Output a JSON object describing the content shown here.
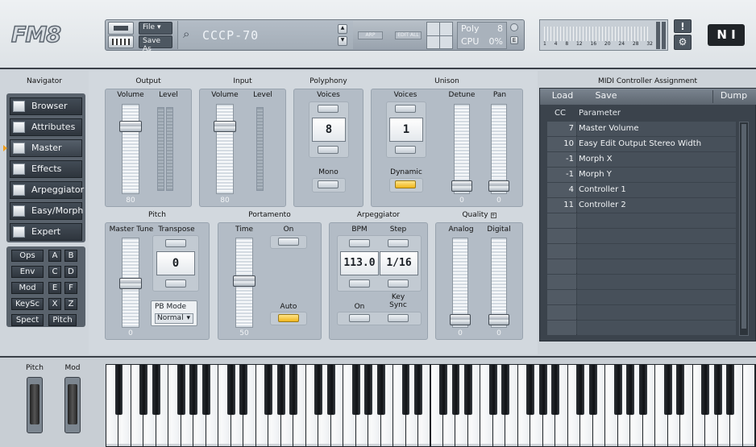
{
  "header": {
    "logo": "FM8",
    "file_label": "File",
    "saveas_label": "Save As",
    "program_name": "CCCP-70",
    "arp_label": "ARP",
    "edit_all_label": "EDIT ALL",
    "poly_label": "Poly",
    "poly_value": "8",
    "cpu_label": "CPU",
    "cpu_value": "0%",
    "spectrum_ticks": [
      "1",
      "4",
      "8",
      "12",
      "16",
      "20",
      "24",
      "28",
      "32"
    ],
    "ni_logo": "N I",
    "alert_label": "!"
  },
  "navigator": {
    "title": "Navigator",
    "items": [
      {
        "label": "Browser",
        "icon": "browser-icon"
      },
      {
        "label": "Attributes",
        "icon": "attributes-icon"
      },
      {
        "label": "Master",
        "icon": "master-gear-icon"
      },
      {
        "label": "Effects",
        "icon": "effects-icon"
      },
      {
        "label": "Arpeggiator",
        "icon": "arpeggiator-icon"
      },
      {
        "label": "Easy/Morph",
        "icon": "easy-morph-icon"
      },
      {
        "label": "Expert",
        "icon": "expert-icon"
      }
    ],
    "selected": "Master",
    "grid": [
      [
        "Ops",
        "A",
        "B"
      ],
      [
        "Env",
        "C",
        "D"
      ],
      [
        "Mod",
        "E",
        "F"
      ],
      [
        "KeySc",
        "X",
        "Z"
      ],
      [
        "Spect",
        "Pitch"
      ]
    ]
  },
  "output": {
    "title": "Output",
    "volume_label": "Volume",
    "level_label": "Level",
    "volume_value": "80"
  },
  "input": {
    "title": "Input",
    "volume_label": "Volume",
    "level_label": "Level",
    "volume_value": "80"
  },
  "polyphony": {
    "title": "Polyphony",
    "voices_label": "Voices",
    "voices_value": "8",
    "mono_label": "Mono"
  },
  "unison": {
    "title": "Unison",
    "voices_label": "Voices",
    "voices_value": "1",
    "dynamic_label": "Dynamic",
    "detune_label": "Detune",
    "pan_label": "Pan",
    "detune_value": "0",
    "pan_value": "0"
  },
  "pitch": {
    "title": "Pitch",
    "master_tune_label": "Master Tune",
    "transpose_label": "Transpose",
    "transpose_value": "0",
    "master_tune_value": "0",
    "pb_mode_label": "PB Mode",
    "pb_mode_value": "Normal"
  },
  "portamento": {
    "title": "Portamento",
    "time_label": "Time",
    "on_label": "On",
    "auto_label": "Auto",
    "time_value": "50"
  },
  "arpeggiator": {
    "title": "Arpeggiator",
    "bpm_label": "BPM",
    "step_label": "Step",
    "bpm_value": "113.0",
    "step_value": "1/16",
    "on_label": "On",
    "keysync_label": "Key\nSync"
  },
  "quality": {
    "title": "Quality",
    "analog_label": "Analog",
    "digital_label": "Digital",
    "analog_value": "0",
    "digital_value": "0"
  },
  "midi": {
    "title": "MIDI Controller Assignment",
    "load_label": "Load",
    "save_label": "Save",
    "dump_label": "Dump",
    "cc_header": "CC",
    "param_header": "Parameter",
    "rows": [
      {
        "cc": "7",
        "param": "Master Volume"
      },
      {
        "cc": "10",
        "param": "Easy Edit Output Stereo Width"
      },
      {
        "cc": "-1",
        "param": "Morph X"
      },
      {
        "cc": "-1",
        "param": "Morph Y"
      },
      {
        "cc": "4",
        "param": "Controller 1"
      },
      {
        "cc": "11",
        "param": "Controller 2"
      }
    ]
  },
  "wheels": {
    "pitch_label": "Pitch",
    "mod_label": "Mod"
  },
  "colors": {
    "accent_button": "#f0b61c",
    "panel": "#b3bcc6",
    "dark": "#3b434c"
  }
}
